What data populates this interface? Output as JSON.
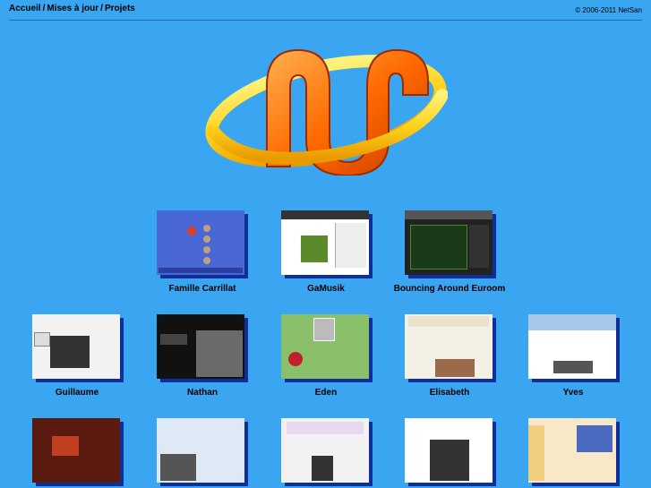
{
  "nav": {
    "home": "Accueil",
    "updates": "Mises à jour",
    "projects": "Projets",
    "sep1": "/",
    "sep2": "/"
  },
  "copyright": "© 2006-2011 NetSan",
  "logo_icon": "netsan-logo",
  "projects": [
    {
      "label": "Famille Carrillat"
    },
    {
      "label": "GaMusik"
    },
    {
      "label": "Bouncing Around Euroom"
    },
    {
      "label": "Guillaume"
    },
    {
      "label": "Nathan"
    },
    {
      "label": "Eden"
    },
    {
      "label": "Elisabeth"
    },
    {
      "label": "Yves"
    },
    {
      "label": ""
    },
    {
      "label": ""
    },
    {
      "label": ""
    },
    {
      "label": ""
    },
    {
      "label": ""
    }
  ],
  "colors": {
    "background": "#3aa5f0",
    "shadow": "#0c2f9c"
  }
}
